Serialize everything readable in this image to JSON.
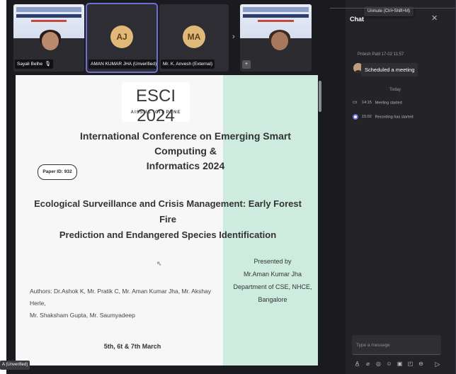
{
  "participants": [
    {
      "name": "Sayali Belhe",
      "type": "video",
      "mic": "mic-icon"
    },
    {
      "name": "AMAN KUMAR JHA (Unverified)",
      "type": "avatar",
      "initials": "AJ"
    },
    {
      "name": "Mr. K. Anvesh (External)",
      "type": "avatar",
      "initials": "MA"
    },
    {
      "name": "",
      "type": "video",
      "more_count": "+"
    }
  ],
  "strip": {
    "next_label": "›"
  },
  "slide": {
    "logo_title": "ESCI 2024",
    "logo_sub": "AISSMS IOIT PUNE",
    "conf_title_1": "International Conference on Emerging Smart Computing &",
    "conf_title_2": "Informatics 2024",
    "paper_id": "Paper ID:  932",
    "paper_title_1": "Ecological Surveillance and Crisis Management: Early Forest Fire",
    "paper_title_2": "Prediction and Endangered Species Identification",
    "presented_1": "Presented by",
    "presented_2": "Mr.Aman Kumar Jha",
    "presented_3": "Department of CSE, NHCE,",
    "presented_4": "Bangalore",
    "authors_1": "Authors: Dr.Ashok K, Mr. Pratik C, Mr. Aman Kumar Jha, Mr. Akshay Herle,",
    "authors_2": "Mr. Shaksham Gupta, Mr. Saumyadeep",
    "dates": "5th, 6t & 7th March"
  },
  "self_tag": "A (Unverified)",
  "chat": {
    "title": "Chat",
    "close_label": "✕",
    "tooltip": "Unmute (Ctrl+Shift+M)",
    "message_meta": "Pritesh Patil  17-02 11:57",
    "message_text": "Scheduled a meeting",
    "today_label": "Today",
    "events": [
      {
        "time": "14:15",
        "text": "Meeting started",
        "icon": "meeting-icon"
      },
      {
        "time": "15:02",
        "text": "Recording has started",
        "icon": "recording-icon"
      }
    ],
    "composer_placeholder": "Type a message",
    "toolbar_icons": [
      "format-icon",
      "attach-icon",
      "loop-icon",
      "emoji-icon",
      "gif-icon",
      "sticker-icon",
      "more-icon"
    ],
    "send_icon": "send-icon"
  },
  "colors": {
    "accent": "#6b6fd6",
    "slide_teal": "#cdebdf",
    "panel": "#242428"
  }
}
